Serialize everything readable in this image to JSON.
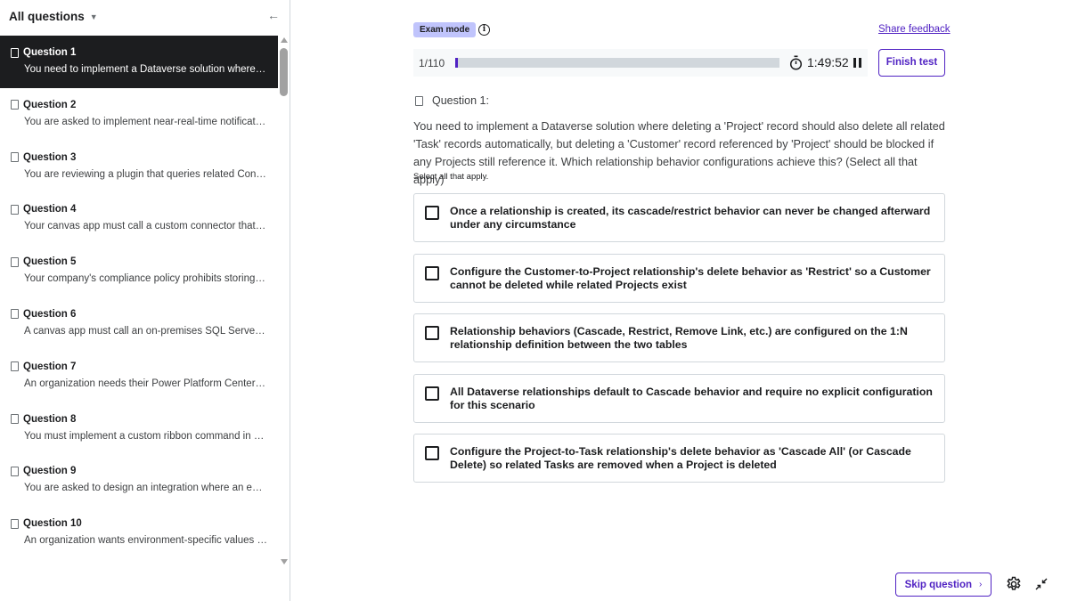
{
  "sidebar": {
    "title": "All questions",
    "collapse_icon": "arrow-left-icon",
    "items": [
      {
        "label": "Question 1",
        "preview": "You need to implement a Dataverse solution where deleting a 'Project' record should also delete all related 'Task' records"
      },
      {
        "label": "Question 2",
        "preview": "You are asked to implement near-real-time notification when records change"
      },
      {
        "label": "Question 3",
        "preview": "You are reviewing a plugin that queries related Contact records"
      },
      {
        "label": "Question 4",
        "preview": "Your canvas app must call a custom connector that wraps an API"
      },
      {
        "label": "Question 5",
        "preview": "Your company's compliance policy prohibits storing plain text secrets"
      },
      {
        "label": "Question 6",
        "preview": "A canvas app must call an on-premises SQL Server database"
      },
      {
        "label": "Question 7",
        "preview": "An organization needs their Power Platform Center of Excellence"
      },
      {
        "label": "Question 8",
        "preview": "You must implement a custom ribbon command in a model-driven app"
      },
      {
        "label": "Question 9",
        "preview": "You are asked to design an integration where an external system"
      },
      {
        "label": "Question 10",
        "preview": "An organization wants environment-specific values (like URLs)"
      }
    ]
  },
  "header": {
    "exam_mode_label": "Exam mode",
    "share_feedback_label": "Share feedback"
  },
  "progress": {
    "count": "1/110",
    "fraction": 0.009,
    "timer": "1:49:52",
    "finish_label": "Finish test"
  },
  "question": {
    "title": "Question 1:",
    "body": "You need to implement a Dataverse solution where deleting a 'Project' record should also delete all related 'Task' records automatically, but deleting a 'Customer' record referenced by 'Project' should be blocked if any Projects still reference it. Which relationship behavior configurations achieve this? (Select all that apply)",
    "hint": "Select all that apply.",
    "options": [
      "Once a relationship is created, its cascade/restrict behavior can never be changed afterward under any circumstance",
      "Configure the Customer-to-Project relationship's delete behavior as 'Restrict' so a Customer cannot be deleted while related Projects exist",
      "Relationship behaviors (Cascade, Restrict, Remove Link, etc.) are configured on the 1:N relationship definition between the two tables",
      "All Dataverse relationships default to Cascade behavior and require no explicit configuration for this scenario",
      "Configure the Project-to-Task relationship's delete behavior as 'Cascade All' (or Cascade Delete) so related Tasks are removed when a Project is deleted"
    ]
  },
  "footer": {
    "skip_label": "Skip question"
  },
  "colors": {
    "accent": "#5022c3",
    "badge_bg": "#c0c4fc",
    "active_item_bg": "#1c1d1f"
  }
}
